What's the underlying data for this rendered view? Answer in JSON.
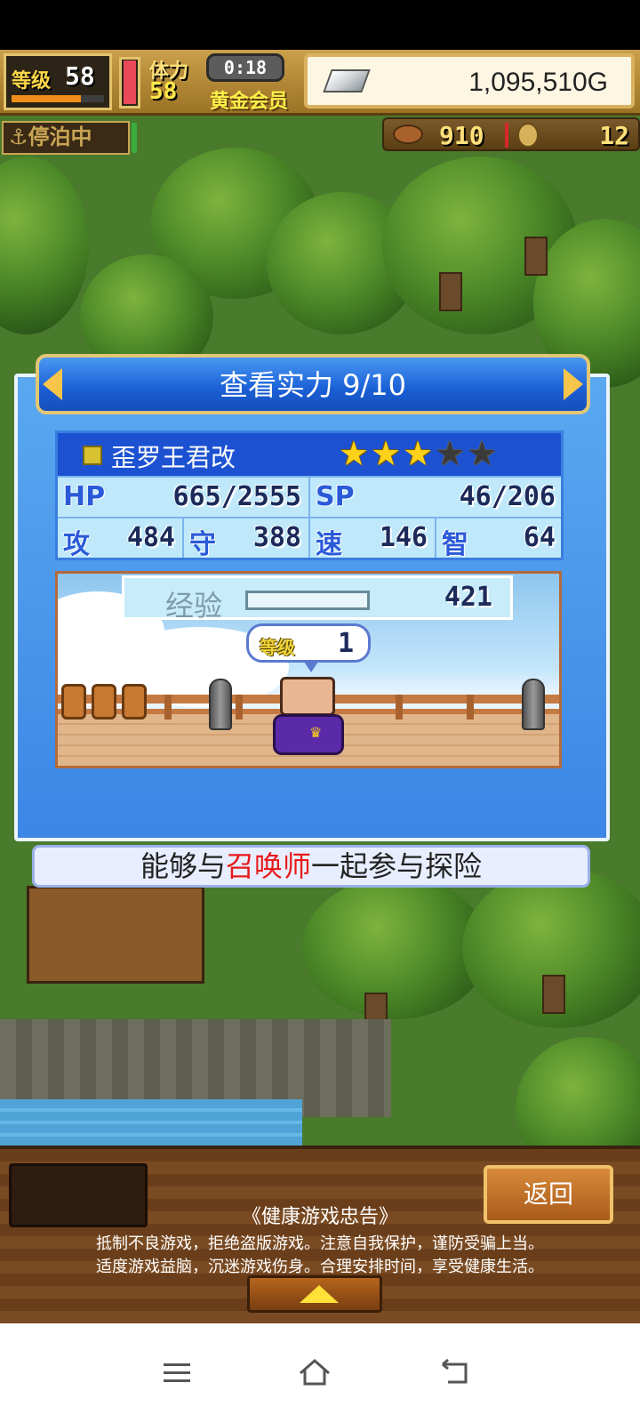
{
  "hud": {
    "level_label": "等级",
    "level_value": "58",
    "level_progress": 0.75,
    "stamina_label": "体力",
    "stamina_value": "58",
    "stamina_fill": 0.95,
    "timer": "0:18",
    "membership": "黄金会员",
    "gold": "1,095,510G"
  },
  "status": {
    "dock_label": "⚓停泊中",
    "food_count": "910",
    "coin_count": "12"
  },
  "dialog": {
    "title": "查看实力 9/10",
    "character": {
      "name": "歪罗王君改",
      "stars_filled": 3,
      "stars_total": 5,
      "hp_label": "HP",
      "hp_value": "665/2555",
      "sp_label": "SP",
      "sp_value": "46/206",
      "atk_label": "攻",
      "atk_value": "484",
      "def_label": "守",
      "def_value": "388",
      "spd_label": "速",
      "spd_value": "146",
      "int_label": "智",
      "int_value": "64"
    },
    "scene": {
      "exp_label": "经验",
      "exp_value": "421",
      "exp_fill": 0.0,
      "bubble_level_label": "等级",
      "bubble_level_value": "1"
    },
    "caption_before": "能够与",
    "caption_highlight": "召唤师",
    "caption_after": "一起参与探险"
  },
  "bottom": {
    "back_label": "返回",
    "notice_title": "《健康游戏忠告》",
    "notice_line1": "抵制不良游戏，拒绝盗版游戏。注意自我保护，谨防受骗上当。",
    "notice_line2": "适度游戏益脑，沉迷游戏伤身。合理安排时间，享受健康生活。"
  },
  "navbar": {
    "menu_icon": "menu-icon",
    "home_icon": "home-icon",
    "back_icon": "back-icon"
  }
}
